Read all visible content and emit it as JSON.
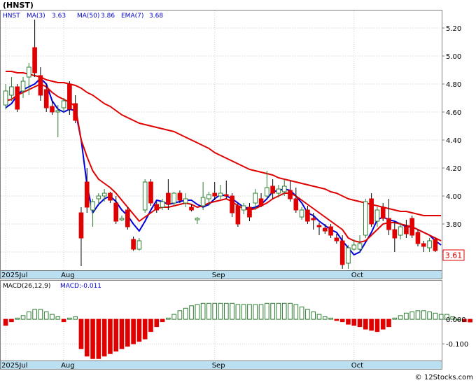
{
  "header": {
    "ticker": "(HNST)",
    "legend": [
      {
        "label": "HNST",
        "color": "#0000cc"
      },
      {
        "label": "MA(3)",
        "value": "3.63",
        "color": "#0000cc"
      },
      {
        "label": "MA(50)",
        "value": "3.86",
        "color": "#0000cc"
      },
      {
        "label": "EMA(7)",
        "value": "3.68",
        "color": "#0000cc"
      }
    ]
  },
  "colors": {
    "up": "#2e7d32",
    "down": "#e00000",
    "ma3": "#0000dd",
    "ma50": "#e00000",
    "ema7": "#e00000",
    "axis_band": "#b9dff0",
    "price_tag": "#e00000",
    "macd_up": "#2e7d32",
    "macd_down": "#e00000"
  },
  "macd_header": {
    "label": "MACD(26,12,9)",
    "value": "MACD:-0.011"
  },
  "footer": {
    "watermark": "© 12Stocks.com"
  },
  "price_tag": "3.61",
  "axis": {
    "month_labels": [
      "2025Jul",
      "Aug",
      "Sep",
      "Oct"
    ],
    "month_index": [
      0,
      10,
      36,
      60
    ]
  },
  "chart_data": [
    {
      "type": "candlestick",
      "name": "price",
      "ylim": [
        3.48,
        5.3
      ],
      "yticks": [
        3.6,
        3.8,
        4.0,
        4.2,
        4.4,
        4.6,
        4.8,
        5.0,
        5.2
      ],
      "ytick_labels": [
        "3.60",
        "3.80",
        "4.00",
        "4.20",
        "4.40",
        "4.60",
        "4.80",
        "5.00",
        "5.20"
      ],
      "candles": [
        {
          "o": 4.65,
          "h": 4.8,
          "l": 4.62,
          "c": 4.75
        },
        {
          "o": 4.72,
          "h": 4.85,
          "l": 4.68,
          "c": 4.78
        },
        {
          "o": 4.78,
          "h": 4.8,
          "l": 4.6,
          "c": 4.62
        },
        {
          "o": 4.75,
          "h": 4.85,
          "l": 4.7,
          "c": 4.82
        },
        {
          "o": 4.85,
          "h": 4.95,
          "l": 4.72,
          "c": 4.92
        },
        {
          "o": 5.06,
          "h": 5.26,
          "l": 4.85,
          "c": 4.88
        },
        {
          "o": 4.86,
          "h": 4.92,
          "l": 4.68,
          "c": 4.72
        },
        {
          "o": 4.76,
          "h": 4.8,
          "l": 4.6,
          "c": 4.63
        },
        {
          "o": 4.64,
          "h": 4.68,
          "l": 4.58,
          "c": 4.6
        },
        {
          "o": 4.6,
          "h": 4.65,
          "l": 4.42,
          "c": 4.61
        },
        {
          "o": 4.63,
          "h": 4.7,
          "l": 4.6,
          "c": 4.68
        },
        {
          "o": 4.8,
          "h": 4.82,
          "l": 4.58,
          "c": 4.62
        },
        {
          "o": 4.66,
          "h": 4.72,
          "l": 4.52,
          "c": 4.54
        },
        {
          "o": 3.88,
          "h": 3.92,
          "l": 3.5,
          "c": 3.7
        },
        {
          "o": 4.1,
          "h": 4.2,
          "l": 3.88,
          "c": 3.92
        },
        {
          "o": 3.9,
          "h": 3.98,
          "l": 3.78,
          "c": 3.96
        },
        {
          "o": 3.98,
          "h": 4.02,
          "l": 3.94,
          "c": 4.0
        },
        {
          "o": 4.0,
          "h": 4.05,
          "l": 3.96,
          "c": 4.02
        },
        {
          "o": 4.02,
          "h": 4.03,
          "l": 3.95,
          "c": 3.97
        },
        {
          "o": 3.95,
          "h": 4.0,
          "l": 3.8,
          "c": 3.82
        },
        {
          "o": 3.83,
          "h": 3.86,
          "l": 3.82,
          "c": 3.84
        },
        {
          "o": 3.9,
          "h": 3.92,
          "l": 3.76,
          "c": 3.78
        },
        {
          "o": 3.69,
          "h": 3.71,
          "l": 3.61,
          "c": 3.62
        },
        {
          "o": 3.62,
          "h": 3.7,
          "l": 3.61,
          "c": 3.68
        },
        {
          "o": 3.9,
          "h": 4.12,
          "l": 3.88,
          "c": 4.1
        },
        {
          "o": 4.1,
          "h": 4.12,
          "l": 3.93,
          "c": 3.95
        },
        {
          "o": 3.94,
          "h": 3.96,
          "l": 3.88,
          "c": 3.9
        },
        {
          "o": 3.92,
          "h": 3.98,
          "l": 3.9,
          "c": 3.96
        },
        {
          "o": 4.02,
          "h": 4.12,
          "l": 3.9,
          "c": 3.94
        },
        {
          "o": 3.95,
          "h": 4.03,
          "l": 3.93,
          "c": 4.02
        },
        {
          "o": 4.02,
          "h": 4.04,
          "l": 3.95,
          "c": 3.97
        },
        {
          "o": 3.95,
          "h": 4.02,
          "l": 3.92,
          "c": 3.98
        },
        {
          "o": 3.92,
          "h": 3.94,
          "l": 3.89,
          "c": 3.9
        },
        {
          "o": 3.83,
          "h": 3.85,
          "l": 3.8,
          "c": 3.84
        },
        {
          "o": 3.93,
          "h": 4.1,
          "l": 3.9,
          "c": 3.99
        },
        {
          "o": 3.98,
          "h": 4.03,
          "l": 3.93,
          "c": 4.01
        },
        {
          "o": 4.02,
          "h": 4.1,
          "l": 3.97,
          "c": 4.0
        },
        {
          "o": 4.0,
          "h": 4.08,
          "l": 3.98,
          "c": 4.02
        },
        {
          "o": 4.01,
          "h": 4.11,
          "l": 3.98,
          "c": 4.0
        },
        {
          "o": 4.0,
          "h": 4.02,
          "l": 3.85,
          "c": 3.88
        },
        {
          "o": 3.93,
          "h": 3.95,
          "l": 3.78,
          "c": 3.8
        },
        {
          "o": 3.9,
          "h": 3.95,
          "l": 3.87,
          "c": 3.93
        },
        {
          "o": 3.92,
          "h": 3.95,
          "l": 3.82,
          "c": 3.85
        },
        {
          "o": 3.95,
          "h": 4.05,
          "l": 3.9,
          "c": 4.02
        },
        {
          "o": 3.98,
          "h": 4.02,
          "l": 3.92,
          "c": 3.93
        },
        {
          "o": 4.0,
          "h": 4.18,
          "l": 3.98,
          "c": 4.06
        },
        {
          "o": 4.07,
          "h": 4.12,
          "l": 3.98,
          "c": 4.02
        },
        {
          "o": 4.02,
          "h": 4.08,
          "l": 3.99,
          "c": 4.05
        },
        {
          "o": 4.03,
          "h": 4.12,
          "l": 4.0,
          "c": 4.07
        },
        {
          "o": 4.04,
          "h": 4.11,
          "l": 3.96,
          "c": 3.98
        },
        {
          "o": 3.98,
          "h": 4.06,
          "l": 3.88,
          "c": 3.9
        },
        {
          "o": 3.85,
          "h": 3.92,
          "l": 3.83,
          "c": 3.9
        },
        {
          "o": 3.9,
          "h": 3.93,
          "l": 3.8,
          "c": 3.82
        },
        {
          "o": 3.84,
          "h": 3.88,
          "l": 3.76,
          "c": 3.83
        },
        {
          "o": 3.79,
          "h": 3.81,
          "l": 3.72,
          "c": 3.78
        },
        {
          "o": 3.77,
          "h": 3.8,
          "l": 3.73,
          "c": 3.75
        },
        {
          "o": 3.78,
          "h": 3.8,
          "l": 3.7,
          "c": 3.72
        },
        {
          "o": 3.7,
          "h": 3.73,
          "l": 3.66,
          "c": 3.68
        },
        {
          "o": 3.68,
          "h": 3.72,
          "l": 3.48,
          "c": 3.51
        },
        {
          "o": 3.52,
          "h": 3.65,
          "l": 3.48,
          "c": 3.63
        },
        {
          "o": 3.62,
          "h": 3.69,
          "l": 3.61,
          "c": 3.65
        },
        {
          "o": 3.62,
          "h": 3.72,
          "l": 3.6,
          "c": 3.66
        },
        {
          "o": 3.72,
          "h": 3.98,
          "l": 3.7,
          "c": 3.96
        },
        {
          "o": 3.98,
          "h": 4.02,
          "l": 3.78,
          "c": 3.8
        },
        {
          "o": 3.82,
          "h": 3.92,
          "l": 3.78,
          "c": 3.9
        },
        {
          "o": 3.92,
          "h": 3.95,
          "l": 3.82,
          "c": 3.84
        },
        {
          "o": 3.84,
          "h": 3.98,
          "l": 3.72,
          "c": 3.76
        },
        {
          "o": 3.76,
          "h": 3.82,
          "l": 3.6,
          "c": 3.7
        },
        {
          "o": 3.72,
          "h": 3.81,
          "l": 3.69,
          "c": 3.78
        },
        {
          "o": 3.78,
          "h": 3.83,
          "l": 3.7,
          "c": 3.73
        },
        {
          "o": 3.84,
          "h": 3.86,
          "l": 3.7,
          "c": 3.72
        },
        {
          "o": 3.74,
          "h": 3.76,
          "l": 3.64,
          "c": 3.66
        },
        {
          "o": 3.66,
          "h": 3.68,
          "l": 3.6,
          "c": 3.64
        },
        {
          "o": 3.63,
          "h": 3.7,
          "l": 3.6,
          "c": 3.68
        },
        {
          "o": 3.69,
          "h": 3.7,
          "l": 3.6,
          "c": 3.61
        }
      ],
      "series": [
        {
          "name": "MA(3)",
          "style": "line",
          "values": [
            4.63,
            4.66,
            4.72,
            4.76,
            4.78,
            4.8,
            4.84,
            4.8,
            4.68,
            4.62,
            4.6,
            4.62,
            4.61,
            4.4,
            4.08,
            3.88,
            3.94,
            3.98,
            4.0,
            3.96,
            3.9,
            3.86,
            3.8,
            3.75,
            3.82,
            3.9,
            3.97,
            3.96,
            3.94,
            3.95,
            3.96,
            3.97,
            3.97,
            3.94,
            3.92,
            3.94,
            3.98,
            4.01,
            4.0,
            3.98,
            3.95,
            3.92,
            3.91,
            3.92,
            3.94,
            3.98,
            4.03,
            4.04,
            4.05,
            4.04,
            4.0,
            3.95,
            3.88,
            3.86,
            3.82,
            3.79,
            3.76,
            3.74,
            3.68,
            3.63,
            3.58,
            3.6,
            3.67,
            3.74,
            3.83,
            3.85,
            3.83,
            3.82,
            3.8,
            3.78,
            3.78,
            3.76,
            3.74,
            3.72,
            3.68,
            3.65
          ]
        },
        {
          "name": "MA(50)",
          "values": [
            4.89,
            4.89,
            4.88,
            4.88,
            4.87,
            4.86,
            4.85,
            4.83,
            4.82,
            4.81,
            4.81,
            4.8,
            4.79,
            4.77,
            4.74,
            4.72,
            4.69,
            4.66,
            4.64,
            4.61,
            4.58,
            4.56,
            4.54,
            4.52,
            4.51,
            4.5,
            4.49,
            4.48,
            4.47,
            4.46,
            4.44,
            4.42,
            4.4,
            4.38,
            4.36,
            4.34,
            4.31,
            4.29,
            4.27,
            4.25,
            4.23,
            4.21,
            4.19,
            4.18,
            4.17,
            4.16,
            4.15,
            4.13,
            4.12,
            4.11,
            4.1,
            4.09,
            4.08,
            4.07,
            4.06,
            4.05,
            4.03,
            4.02,
            4.0,
            3.98,
            3.97,
            3.96,
            3.95,
            3.94,
            3.93,
            3.92,
            3.91,
            3.9,
            3.89,
            3.89,
            3.88,
            3.87,
            3.86,
            3.86,
            3.86,
            3.86
          ]
        },
        {
          "name": "EMA(7)",
          "values": [
            4.68,
            4.69,
            4.72,
            4.74,
            4.76,
            4.78,
            4.8,
            4.78,
            4.74,
            4.71,
            4.69,
            4.67,
            4.64,
            4.4,
            4.28,
            4.18,
            4.12,
            4.09,
            4.06,
            4.02,
            3.97,
            3.92,
            3.87,
            3.82,
            3.85,
            3.88,
            3.91,
            3.92,
            3.92,
            3.93,
            3.94,
            3.95,
            3.94,
            3.92,
            3.93,
            3.95,
            3.96,
            3.97,
            3.98,
            3.96,
            3.93,
            3.91,
            3.9,
            3.91,
            3.93,
            3.95,
            3.98,
            4.0,
            4.02,
            4.02,
            4.0,
            3.97,
            3.94,
            3.91,
            3.88,
            3.85,
            3.82,
            3.79,
            3.76,
            3.7,
            3.68,
            3.67,
            3.68,
            3.72,
            3.76,
            3.8,
            3.81,
            3.81,
            3.8,
            3.79,
            3.78,
            3.76,
            3.74,
            3.72,
            3.7,
            3.68
          ]
        }
      ]
    },
    {
      "type": "bar",
      "name": "MACD",
      "ylim": [
        -0.165,
        0.12
      ],
      "yticks": [
        0.0,
        -0.1
      ],
      "ytick_labels": [
        "0.000",
        "-0.100"
      ],
      "values": [
        -0.025,
        -0.01,
        0.005,
        0.015,
        0.03,
        0.04,
        0.04,
        0.03,
        0.02,
        0.01,
        -0.01,
        0.005,
        0.01,
        -0.12,
        -0.15,
        -0.16,
        -0.16,
        -0.15,
        -0.14,
        -0.13,
        -0.12,
        -0.11,
        -0.1,
        -0.09,
        -0.08,
        -0.05,
        -0.03,
        -0.01,
        0.005,
        0.02,
        0.035,
        0.045,
        0.055,
        0.06,
        0.065,
        0.065,
        0.065,
        0.065,
        0.065,
        0.065,
        0.06,
        0.06,
        0.06,
        0.06,
        0.06,
        0.065,
        0.065,
        0.065,
        0.065,
        0.065,
        0.06,
        0.05,
        0.04,
        0.03,
        0.02,
        0.01,
        0.005,
        -0.005,
        -0.01,
        -0.02,
        -0.025,
        -0.03,
        -0.04,
        -0.045,
        -0.05,
        -0.04,
        -0.03,
        0.005,
        0.015,
        0.025,
        0.03,
        0.035,
        0.035,
        0.03,
        0.025,
        0.02,
        0.02,
        0.01,
        0.0,
        -0.01,
        -0.011
      ]
    }
  ]
}
